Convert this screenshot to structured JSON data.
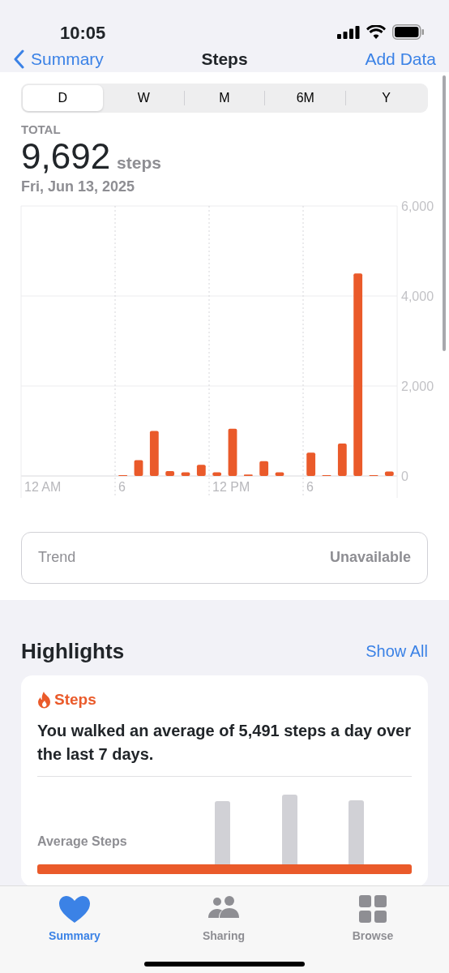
{
  "status_bar": {
    "time": "10:05"
  },
  "nav": {
    "back": "Summary",
    "title": "Steps",
    "action": "Add Data"
  },
  "tabs": [
    {
      "label": "D",
      "selected": true
    },
    {
      "label": "W",
      "selected": false
    },
    {
      "label": "M",
      "selected": false
    },
    {
      "label": "6M",
      "selected": false
    },
    {
      "label": "Y",
      "selected": false
    }
  ],
  "summary": {
    "label": "TOTAL",
    "value": "9,692",
    "unit": "steps",
    "date": "Fri, Jun 13, 2025"
  },
  "chart": {
    "chart_data": {
      "type": "bar",
      "categories": [
        null,
        null,
        null,
        null,
        null,
        null,
        null,
        null,
        null,
        null,
        null,
        null,
        null,
        null,
        null,
        null,
        null,
        null,
        null,
        null,
        null,
        null,
        null,
        null
      ],
      "series": [
        {
          "color": "#ea5a2a",
          "values": [
            null,
            null,
            null,
            null,
            null,
            null,
            10,
            350,
            1000,
            110,
            80,
            250,
            80,
            1050,
            30,
            330,
            80,
            null,
            520,
            10,
            720,
            4500,
            10,
            100
          ]
        }
      ],
      "ylim": [
        0,
        6000
      ],
      "yticks": [
        {
          "value": 0,
          "label": "0"
        },
        {
          "value": 2000,
          "label": "2,000"
        },
        {
          "value": 4000,
          "label": "4,000"
        },
        {
          "value": 6000,
          "label": "6,000"
        }
      ]
    },
    "x_labels": [
      "12 AM",
      "6",
      "12 PM",
      "6"
    ]
  },
  "trend": {
    "label": "Trend",
    "value": "Unavailable"
  },
  "highlights": {
    "title": "Highlights",
    "action": "Show All",
    "card": {
      "category": "Steps",
      "text": "You walked an average of 5,491 steps a day over the last 7 days.",
      "chart_label": "Average Steps"
    }
  },
  "tab_bar": [
    {
      "label": "Summary",
      "selected": true,
      "kind": "heart"
    },
    {
      "label": "Sharing",
      "selected": false,
      "kind": "people"
    },
    {
      "label": "Browse",
      "selected": false,
      "kind": "grid"
    }
  ]
}
